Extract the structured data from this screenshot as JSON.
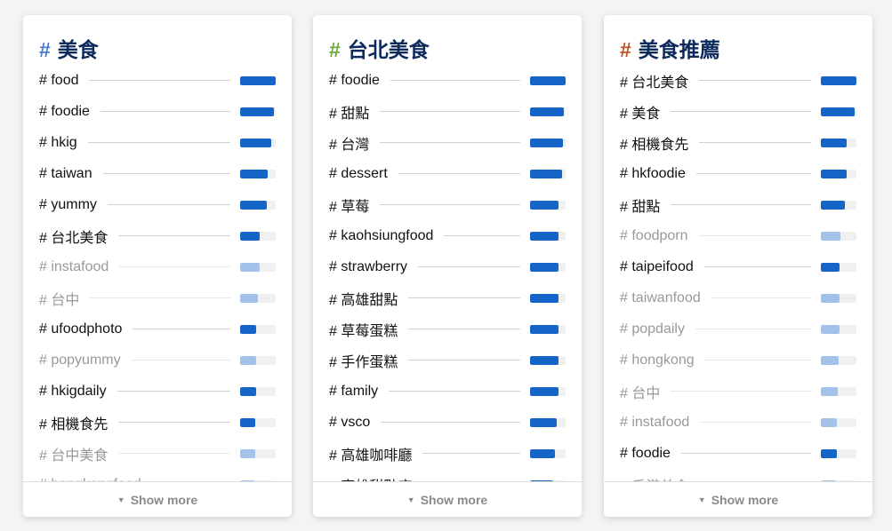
{
  "colors": {
    "bar": "#1565c8",
    "bar_dim": "#a3c2ea",
    "title": "#0d2a5c"
  },
  "show_more_label": "Show more",
  "cards": [
    {
      "title": "美食",
      "hash": "#",
      "hash_color": "#4a7cc9",
      "items": [
        {
          "label": "# food",
          "value": 1.0,
          "dim": false
        },
        {
          "label": "# foodie",
          "value": 0.95,
          "dim": false
        },
        {
          "label": "# hkig",
          "value": 0.88,
          "dim": false
        },
        {
          "label": "# taiwan",
          "value": 0.78,
          "dim": false
        },
        {
          "label": "# yummy",
          "value": 0.75,
          "dim": false
        },
        {
          "label": "# 台北美食",
          "value": 0.55,
          "dim": false
        },
        {
          "label": "# instafood",
          "value": 0.55,
          "dim": true
        },
        {
          "label": "# 台中",
          "value": 0.5,
          "dim": true
        },
        {
          "label": "# ufoodphoto",
          "value": 0.45,
          "dim": false
        },
        {
          "label": "# popyummy",
          "value": 0.45,
          "dim": true
        },
        {
          "label": "# hkigdaily",
          "value": 0.45,
          "dim": false
        },
        {
          "label": "# 相機食先",
          "value": 0.42,
          "dim": false
        },
        {
          "label": "# 台中美食",
          "value": 0.42,
          "dim": true
        },
        {
          "label": "# hongkongfood",
          "value": 0.42,
          "dim": true
        }
      ]
    },
    {
      "title": "台北美食",
      "hash": "#",
      "hash_color": "#6aaa3a",
      "items": [
        {
          "label": "# foodie",
          "value": 1.0,
          "dim": false
        },
        {
          "label": "# 甜點",
          "value": 0.95,
          "dim": false
        },
        {
          "label": "# 台灣",
          "value": 0.92,
          "dim": false
        },
        {
          "label": "# dessert",
          "value": 0.9,
          "dim": false
        },
        {
          "label": "# 草莓",
          "value": 0.8,
          "dim": false
        },
        {
          "label": "# kaohsiungfood",
          "value": 0.8,
          "dim": false
        },
        {
          "label": "# strawberry",
          "value": 0.8,
          "dim": false
        },
        {
          "label": "# 高雄甜點",
          "value": 0.8,
          "dim": false
        },
        {
          "label": "# 草莓蛋糕",
          "value": 0.8,
          "dim": false
        },
        {
          "label": "# 手作蛋糕",
          "value": 0.8,
          "dim": false
        },
        {
          "label": "# family",
          "value": 0.8,
          "dim": false
        },
        {
          "label": "# vsco",
          "value": 0.75,
          "dim": false
        },
        {
          "label": "# 高雄咖啡廳",
          "value": 0.7,
          "dim": false
        },
        {
          "label": "# 高雄甜點店",
          "value": 0.65,
          "dim": false
        }
      ]
    },
    {
      "title": "美食推薦",
      "hash": "#",
      "hash_color": "#c0502a",
      "items": [
        {
          "label": "# 台北美食",
          "value": 1.0,
          "dim": false
        },
        {
          "label": "# 美食",
          "value": 0.95,
          "dim": false
        },
        {
          "label": "# 相機食先",
          "value": 0.72,
          "dim": false
        },
        {
          "label": "# hkfoodie",
          "value": 0.72,
          "dim": false
        },
        {
          "label": "# 甜點",
          "value": 0.68,
          "dim": false
        },
        {
          "label": "# foodporn",
          "value": 0.55,
          "dim": true
        },
        {
          "label": "# taipeifood",
          "value": 0.52,
          "dim": false
        },
        {
          "label": "# taiwanfood",
          "value": 0.52,
          "dim": true
        },
        {
          "label": "# popdaily",
          "value": 0.52,
          "dim": true
        },
        {
          "label": "# hongkong",
          "value": 0.5,
          "dim": true
        },
        {
          "label": "# 台中",
          "value": 0.48,
          "dim": true
        },
        {
          "label": "# instafood",
          "value": 0.45,
          "dim": true
        },
        {
          "label": "# foodie",
          "value": 0.45,
          "dim": false
        },
        {
          "label": "# 香港美食",
          "value": 0.42,
          "dim": true
        }
      ]
    }
  ]
}
